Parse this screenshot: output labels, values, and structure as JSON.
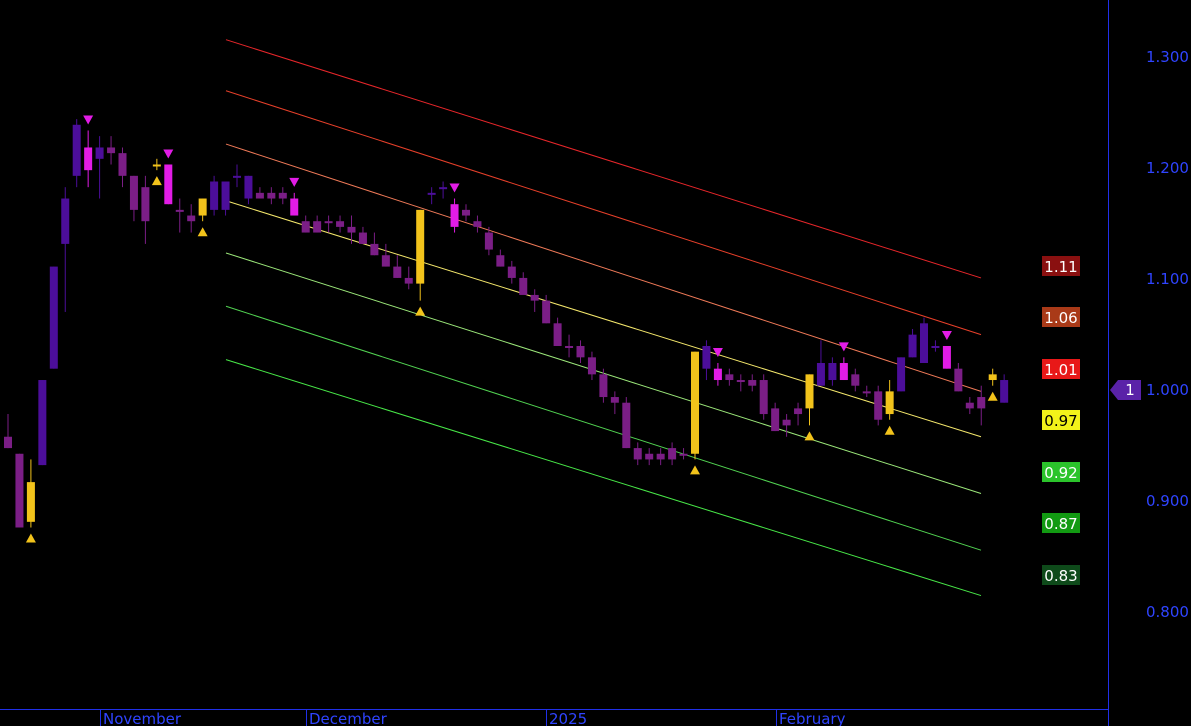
{
  "chart_data": {
    "type": "candlestick",
    "ylim": [
      0.73,
      1.355
    ],
    "y_ticks": [
      "1.300",
      "1.200",
      "1.100",
      "1.000",
      "0.900",
      "0.800"
    ],
    "x_labels": [
      "November",
      "December",
      "2025",
      "February"
    ],
    "current_price": 1.0,
    "current_price_label": "1",
    "candles": [
      {
        "o": 0.97,
        "h": 0.99,
        "l": 0.96,
        "c": 0.96,
        "color": "#7B1E86"
      },
      {
        "o": 0.955,
        "h": 0.955,
        "l": 0.89,
        "c": 0.89,
        "color": "#7B1E86"
      },
      {
        "o": 0.895,
        "h": 0.95,
        "l": 0.89,
        "c": 0.93,
        "color": "#F2C31B"
      },
      {
        "o": 0.945,
        "h": 1.02,
        "l": 0.945,
        "c": 1.02,
        "color": "#4C0E9A"
      },
      {
        "o": 1.03,
        "h": 1.12,
        "l": 1.03,
        "c": 1.12,
        "color": "#4C0E9A"
      },
      {
        "o": 1.14,
        "h": 1.19,
        "l": 1.08,
        "c": 1.18,
        "color": "#4C0E9A"
      },
      {
        "o": 1.2,
        "h": 1.25,
        "l": 1.19,
        "c": 1.245,
        "color": "#4C0E9A"
      },
      {
        "o": 1.225,
        "h": 1.24,
        "l": 1.19,
        "c": 1.205,
        "color": "#E21CE6"
      },
      {
        "o": 1.215,
        "h": 1.235,
        "l": 1.18,
        "c": 1.225,
        "color": "#4C0E9A"
      },
      {
        "o": 1.225,
        "h": 1.235,
        "l": 1.21,
        "c": 1.22,
        "color": "#7B1E86"
      },
      {
        "o": 1.22,
        "h": 1.225,
        "l": 1.19,
        "c": 1.2,
        "color": "#7B1E86"
      },
      {
        "o": 1.2,
        "h": 1.2,
        "l": 1.16,
        "c": 1.17,
        "color": "#7B1E86"
      },
      {
        "o": 1.19,
        "h": 1.2,
        "l": 1.14,
        "c": 1.16,
        "color": "#7B1E86"
      },
      {
        "o": 1.21,
        "h": 1.215,
        "l": 1.205,
        "c": 1.21,
        "color": "#F2C31B"
      },
      {
        "o": 1.21,
        "h": 1.21,
        "l": 1.175,
        "c": 1.175,
        "color": "#E21CE6"
      },
      {
        "o": 1.17,
        "h": 1.18,
        "l": 1.15,
        "c": 1.17,
        "color": "#7B1E86"
      },
      {
        "o": 1.165,
        "h": 1.175,
        "l": 1.15,
        "c": 1.16,
        "color": "#7B1E86"
      },
      {
        "o": 1.165,
        "h": 1.18,
        "l": 1.16,
        "c": 1.18,
        "color": "#F2C31B"
      },
      {
        "o": 1.17,
        "h": 1.2,
        "l": 1.165,
        "c": 1.195,
        "color": "#4C0E9A"
      },
      {
        "o": 1.17,
        "h": 1.19,
        "l": 1.165,
        "c": 1.195,
        "color": "#4C0E9A"
      },
      {
        "o": 1.2,
        "h": 1.21,
        "l": 1.19,
        "c": 1.2,
        "color": "#4C0E9A"
      },
      {
        "o": 1.18,
        "h": 1.2,
        "l": 1.175,
        "c": 1.2,
        "color": "#4C0E9A"
      },
      {
        "o": 1.185,
        "h": 1.19,
        "l": 1.18,
        "c": 1.18,
        "color": "#7B1E86"
      },
      {
        "o": 1.185,
        "h": 1.19,
        "l": 1.175,
        "c": 1.18,
        "color": "#7B1E86"
      },
      {
        "o": 1.185,
        "h": 1.19,
        "l": 1.175,
        "c": 1.18,
        "color": "#7B1E86"
      },
      {
        "o": 1.18,
        "h": 1.185,
        "l": 1.165,
        "c": 1.165,
        "color": "#E21CE6"
      },
      {
        "o": 1.16,
        "h": 1.165,
        "l": 1.15,
        "c": 1.15,
        "color": "#7B1E86"
      },
      {
        "o": 1.16,
        "h": 1.165,
        "l": 1.15,
        "c": 1.15,
        "color": "#7B1E86"
      },
      {
        "o": 1.16,
        "h": 1.165,
        "l": 1.15,
        "c": 1.16,
        "color": "#7B1E86"
      },
      {
        "o": 1.155,
        "h": 1.165,
        "l": 1.15,
        "c": 1.16,
        "color": "#7B1E86"
      },
      {
        "o": 1.155,
        "h": 1.165,
        "l": 1.14,
        "c": 1.15,
        "color": "#7B1E86"
      },
      {
        "o": 1.15,
        "h": 1.155,
        "l": 1.14,
        "c": 1.14,
        "color": "#7B1E86"
      },
      {
        "o": 1.14,
        "h": 1.15,
        "l": 1.13,
        "c": 1.13,
        "color": "#7B1E86"
      },
      {
        "o": 1.13,
        "h": 1.14,
        "l": 1.12,
        "c": 1.12,
        "color": "#7B1E86"
      },
      {
        "o": 1.12,
        "h": 1.13,
        "l": 1.11,
        "c": 1.11,
        "color": "#7B1E86"
      },
      {
        "o": 1.11,
        "h": 1.12,
        "l": 1.1,
        "c": 1.105,
        "color": "#7B1E86"
      },
      {
        "o": 1.105,
        "h": 1.17,
        "l": 1.09,
        "c": 1.17,
        "color": "#F2C31B"
      },
      {
        "o": 1.185,
        "h": 1.19,
        "l": 1.175,
        "c": 1.185,
        "color": "#4C0E9A"
      },
      {
        "o": 1.19,
        "h": 1.195,
        "l": 1.18,
        "c": 1.19,
        "color": "#4C0E9A"
      },
      {
        "o": 1.175,
        "h": 1.18,
        "l": 1.15,
        "c": 1.155,
        "color": "#E21CE6"
      },
      {
        "o": 1.17,
        "h": 1.175,
        "l": 1.16,
        "c": 1.165,
        "color": "#7B1E86"
      },
      {
        "o": 1.16,
        "h": 1.165,
        "l": 1.15,
        "c": 1.155,
        "color": "#7B1E86"
      },
      {
        "o": 1.15,
        "h": 1.155,
        "l": 1.13,
        "c": 1.135,
        "color": "#7B1E86"
      },
      {
        "o": 1.13,
        "h": 1.135,
        "l": 1.12,
        "c": 1.12,
        "color": "#7B1E86"
      },
      {
        "o": 1.12,
        "h": 1.125,
        "l": 1.105,
        "c": 1.11,
        "color": "#7B1E86"
      },
      {
        "o": 1.11,
        "h": 1.115,
        "l": 1.1,
        "c": 1.095,
        "color": "#7B1E86"
      },
      {
        "o": 1.095,
        "h": 1.1,
        "l": 1.08,
        "c": 1.09,
        "color": "#7B1E86"
      },
      {
        "o": 1.09,
        "h": 1.095,
        "l": 1.07,
        "c": 1.07,
        "color": "#7B1E86"
      },
      {
        "o": 1.07,
        "h": 1.075,
        "l": 1.05,
        "c": 1.05,
        "color": "#7B1E86"
      },
      {
        "o": 1.05,
        "h": 1.06,
        "l": 1.04,
        "c": 1.05,
        "color": "#7B1E86"
      },
      {
        "o": 1.05,
        "h": 1.055,
        "l": 1.035,
        "c": 1.04,
        "color": "#7B1E86"
      },
      {
        "o": 1.04,
        "h": 1.045,
        "l": 1.02,
        "c": 1.025,
        "color": "#7B1E86"
      },
      {
        "o": 1.025,
        "h": 1.03,
        "l": 1.0,
        "c": 1.005,
        "color": "#7B1E86"
      },
      {
        "o": 1.005,
        "h": 1.01,
        "l": 0.99,
        "c": 1.0,
        "color": "#7B1E86"
      },
      {
        "o": 1.0,
        "h": 1.005,
        "l": 0.96,
        "c": 0.96,
        "color": "#7B1E86"
      },
      {
        "o": 0.96,
        "h": 0.965,
        "l": 0.945,
        "c": 0.95,
        "color": "#7B1E86"
      },
      {
        "o": 0.955,
        "h": 0.96,
        "l": 0.945,
        "c": 0.95,
        "color": "#7B1E86"
      },
      {
        "o": 0.95,
        "h": 0.96,
        "l": 0.945,
        "c": 0.955,
        "color": "#7B1E86"
      },
      {
        "o": 0.96,
        "h": 0.965,
        "l": 0.945,
        "c": 0.95,
        "color": "#7B1E86"
      },
      {
        "o": 0.955,
        "h": 0.96,
        "l": 0.95,
        "c": 0.955,
        "color": "#7B1E86"
      },
      {
        "o": 0.955,
        "h": 1.045,
        "l": 0.95,
        "c": 1.045,
        "color": "#F2C31B"
      },
      {
        "o": 1.03,
        "h": 1.055,
        "l": 1.02,
        "c": 1.05,
        "color": "#4C0E9A"
      },
      {
        "o": 1.03,
        "h": 1.035,
        "l": 1.015,
        "c": 1.02,
        "color": "#E21CE6"
      },
      {
        "o": 1.025,
        "h": 1.03,
        "l": 1.015,
        "c": 1.02,
        "color": "#7B1E86"
      },
      {
        "o": 1.02,
        "h": 1.025,
        "l": 1.01,
        "c": 1.02,
        "color": "#7B1E86"
      },
      {
        "o": 1.02,
        "h": 1.025,
        "l": 1.01,
        "c": 1.015,
        "color": "#7B1E86"
      },
      {
        "o": 1.02,
        "h": 1.025,
        "l": 0.985,
        "c": 0.99,
        "color": "#7B1E86"
      },
      {
        "o": 0.995,
        "h": 1.0,
        "l": 0.975,
        "c": 0.975,
        "color": "#7B1E86"
      },
      {
        "o": 0.98,
        "h": 0.99,
        "l": 0.97,
        "c": 0.985,
        "color": "#7B1E86"
      },
      {
        "o": 0.99,
        "h": 1.0,
        "l": 0.98,
        "c": 0.995,
        "color": "#7B1E86"
      },
      {
        "o": 0.995,
        "h": 1.025,
        "l": 0.98,
        "c": 1.025,
        "color": "#F2C31B"
      },
      {
        "o": 1.015,
        "h": 1.055,
        "l": 1.015,
        "c": 1.035,
        "color": "#4C0E9A"
      },
      {
        "o": 1.02,
        "h": 1.04,
        "l": 1.015,
        "c": 1.035,
        "color": "#4C0E9A"
      },
      {
        "o": 1.035,
        "h": 1.04,
        "l": 1.02,
        "c": 1.02,
        "color": "#E21CE6"
      },
      {
        "o": 1.025,
        "h": 1.03,
        "l": 1.01,
        "c": 1.015,
        "color": "#7B1E86"
      },
      {
        "o": 1.01,
        "h": 1.015,
        "l": 1.005,
        "c": 1.01,
        "color": "#7B1E86"
      },
      {
        "o": 1.01,
        "h": 1.015,
        "l": 0.98,
        "c": 0.985,
        "color": "#7B1E86"
      },
      {
        "o": 0.99,
        "h": 1.02,
        "l": 0.985,
        "c": 1.01,
        "color": "#F2C31B"
      },
      {
        "o": 1.01,
        "h": 1.04,
        "l": 1.01,
        "c": 1.04,
        "color": "#4C0E9A"
      },
      {
        "o": 1.04,
        "h": 1.065,
        "l": 1.04,
        "c": 1.06,
        "color": "#4C0E9A"
      },
      {
        "o": 1.035,
        "h": 1.075,
        "l": 1.035,
        "c": 1.07,
        "color": "#4C0E9A"
      },
      {
        "o": 1.05,
        "h": 1.055,
        "l": 1.045,
        "c": 1.05,
        "color": "#4C0E9A"
      },
      {
        "o": 1.05,
        "h": 1.05,
        "l": 1.03,
        "c": 1.03,
        "color": "#E21CE6"
      },
      {
        "o": 1.03,
        "h": 1.035,
        "l": 1.01,
        "c": 1.01,
        "color": "#7B1E86"
      },
      {
        "o": 1.0,
        "h": 1.005,
        "l": 0.99,
        "c": 0.995,
        "color": "#7B1E86"
      },
      {
        "o": 1.005,
        "h": 1.015,
        "l": 0.98,
        "c": 0.995,
        "color": "#7B1E86"
      },
      {
        "o": 1.02,
        "h": 1.03,
        "l": 1.015,
        "c": 1.025,
        "color": "#F2C31B"
      },
      {
        "o": 1.0,
        "h": 1.025,
        "l": 1.0,
        "c": 1.02,
        "color": "#4C0E9A"
      }
    ],
    "signals": [
      {
        "index": 2,
        "type": "buy"
      },
      {
        "index": 7,
        "type": "sell"
      },
      {
        "index": 13,
        "type": "buy"
      },
      {
        "index": 14,
        "type": "sell"
      },
      {
        "index": 17,
        "type": "buy"
      },
      {
        "index": 25,
        "type": "sell"
      },
      {
        "index": 36,
        "type": "buy"
      },
      {
        "index": 39,
        "type": "sell"
      },
      {
        "index": 60,
        "type": "buy"
      },
      {
        "index": 62,
        "type": "sell"
      },
      {
        "index": 70,
        "type": "buy"
      },
      {
        "index": 73,
        "type": "sell"
      },
      {
        "index": 77,
        "type": "buy"
      },
      {
        "index": 82,
        "type": "sell"
      },
      {
        "index": 86,
        "type": "buy"
      }
    ],
    "channel": [
      {
        "start": 1.32,
        "end": 1.11,
        "color": "#E8262A"
      },
      {
        "start": 1.275,
        "end": 1.06,
        "color": "#E8402A"
      },
      {
        "start": 1.228,
        "end": 1.01,
        "color": "#F07A58"
      },
      {
        "start": 1.178,
        "end": 0.97,
        "color": "#F5E86C"
      },
      {
        "start": 1.132,
        "end": 0.92,
        "color": "#9CE87A"
      },
      {
        "start": 1.085,
        "end": 0.87,
        "color": "#52D452"
      },
      {
        "start": 1.038,
        "end": 0.83,
        "color": "#48E848"
      }
    ],
    "level_labels": [
      {
        "text": "1.11",
        "bg": "#8A1010",
        "fg": "#FFFFFF"
      },
      {
        "text": "1.06",
        "bg": "#A93A18",
        "fg": "#FFFFFF"
      },
      {
        "text": "1.01",
        "bg": "#E81818",
        "fg": "#FFFFFF"
      },
      {
        "text": "0.97",
        "bg": "#F2F21A",
        "fg": "#000000"
      },
      {
        "text": "0.92",
        "bg": "#2BC42B",
        "fg": "#FFFFFF"
      },
      {
        "text": "0.87",
        "bg": "#129A12",
        "fg": "#FFFFFF"
      },
      {
        "text": "0.83",
        "bg": "#0E4A1A",
        "fg": "#FFFFFF"
      }
    ],
    "colors": {
      "background": "#000000",
      "axis": "#2030E8",
      "axis_text": "#2F44FF",
      "price_marker": "#5A22A8",
      "buy_signal": "#F2C31B",
      "sell_signal": "#E21CE6"
    }
  }
}
